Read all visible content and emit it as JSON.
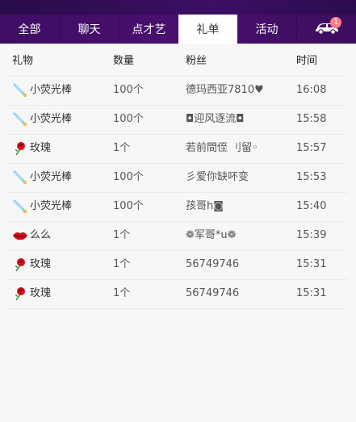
{
  "tabs": [
    {
      "label": "全部"
    },
    {
      "label": "聊天"
    },
    {
      "label": "点才艺"
    },
    {
      "label": "礼单",
      "active": true
    },
    {
      "label": "活动"
    }
  ],
  "car_tab": {
    "badge": "1",
    "icon": "car-icon"
  },
  "table": {
    "headers": {
      "gift": "礼物",
      "count": "数量",
      "fan": "粉丝",
      "time": "时间"
    },
    "rows": [
      {
        "icon": "glow-stick-icon",
        "gift": "小荧光棒",
        "count": "100个",
        "fan": "德玛西亚7810♥",
        "time": "16:08"
      },
      {
        "icon": "glow-stick-icon",
        "gift": "小荧光棒",
        "count": "100个",
        "fan": "◘迎风逐流◘",
        "time": "15:58"
      },
      {
        "icon": "rose-icon",
        "gift": "玫瑰",
        "count": "1个",
        "fan": "若前間侄 刂留◦",
        "time": "15:57"
      },
      {
        "icon": "glow-stick-icon",
        "gift": "小荧光棒",
        "count": "100个",
        "fan": "彡爱你缺吥变",
        "time": "15:53"
      },
      {
        "icon": "glow-stick-icon",
        "gift": "小荧光棒",
        "count": "100个",
        "fan": "孩哥h◙",
        "time": "15:40"
      },
      {
        "icon": "lips-icon",
        "gift": "么么",
        "count": "1个",
        "fan": "❁军哥*u❁",
        "time": "15:39"
      },
      {
        "icon": "rose-icon",
        "gift": "玫瑰",
        "count": "1个",
        "fan": "56749746",
        "time": "15:31"
      },
      {
        "icon": "rose-icon",
        "gift": "玫瑰",
        "count": "1个",
        "fan": "56749746",
        "time": "15:31"
      }
    ]
  }
}
